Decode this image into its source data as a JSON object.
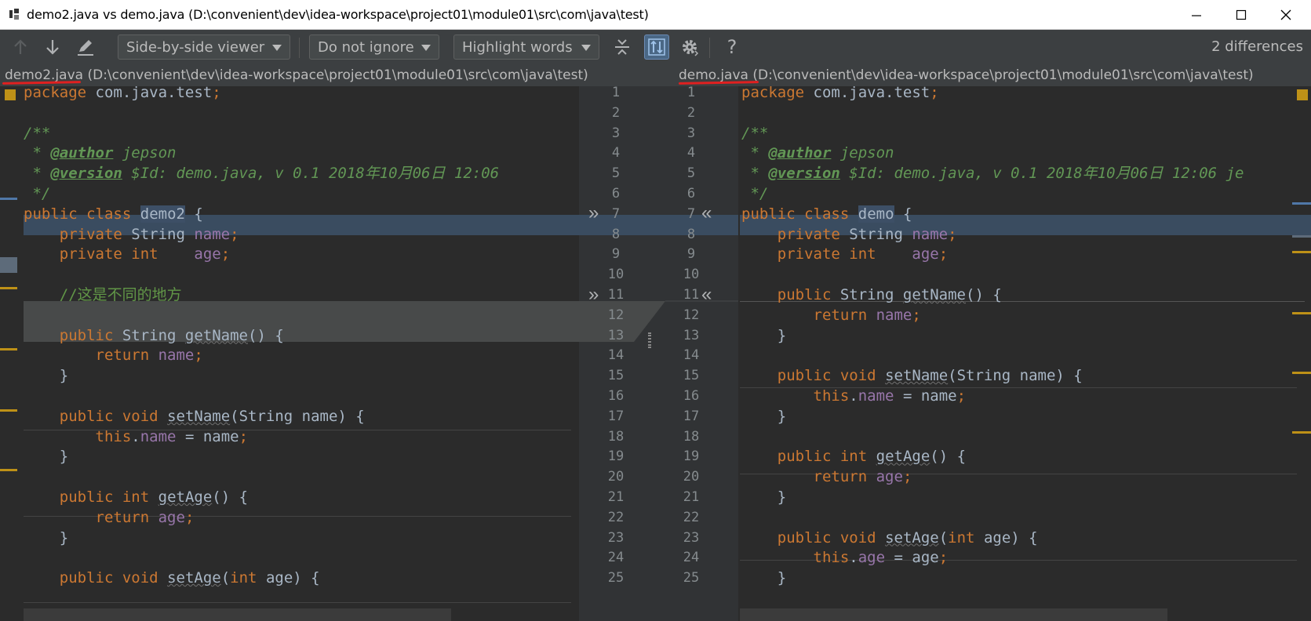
{
  "window": {
    "title": "demo2.java vs demo.java (D:\\convenient\\dev\\idea-workspace\\project01\\module01\\src\\com\\java\\test)"
  },
  "toolbar": {
    "viewer_mode": "Side-by-side viewer",
    "ignore_mode": "Do not ignore",
    "highlight_mode": "Highlight words",
    "differences": "2 differences",
    "help": "?"
  },
  "left_file": {
    "name": "demo2.java",
    "path": " (D:\\convenient\\dev\\idea-workspace\\project01\\module01\\src\\com\\java\\test)"
  },
  "right_file": {
    "name": "demo.java",
    "path": " (D:\\convenient\\dev\\idea-workspace\\project01\\module01\\src\\com\\java\\test)"
  },
  "left_code": [
    "package com.java.test;",
    "",
    "/**",
    " * @author jepson",
    " * @version $Id: demo.java, v 0.1 2018年10月06日 12:06",
    " */",
    "public class demo2 {",
    "    private String name;",
    "    private int    age;",
    "",
    "    //这是不同的地方",
    "",
    "    public String getName() {",
    "        return name;",
    "    }",
    "",
    "    public void setName(String name) {",
    "        this.name = name;",
    "    }",
    "",
    "    public int getAge() {",
    "        return age;",
    "    }",
    "",
    "    public void setAge(int age) {"
  ],
  "right_code": [
    "package com.java.test;",
    "",
    "/**",
    " * @author jepson",
    " * @version $Id: demo.java, v 0.1 2018年10月06日 12:06 je",
    " */",
    "public class demo {",
    "    private String name;",
    "    private int    age;",
    "",
    "    public String getName() {",
    "        return name;",
    "    }",
    "",
    "    public void setName(String name) {",
    "        this.name = name;",
    "    }",
    "",
    "    public int getAge() {",
    "        return age;",
    "    }",
    "",
    "    public void setAge(int age) {",
    "        this.age = age;",
    "    }"
  ],
  "left_line_numbers": [
    "1",
    "2",
    "3",
    "4",
    "5",
    "6",
    "7",
    "8",
    "9",
    "10",
    "11",
    "12",
    "13",
    "14",
    "15",
    "16",
    "17",
    "18",
    "19",
    "20",
    "21",
    "22",
    "23",
    "24",
    "25"
  ],
  "right_line_numbers": [
    "1",
    "2",
    "3",
    "4",
    "5",
    "6",
    "7",
    "8",
    "9",
    "10",
    "11",
    "12",
    "13",
    "14",
    "15",
    "16",
    "17",
    "18",
    "19",
    "20",
    "21",
    "22",
    "23",
    "24",
    "25"
  ],
  "colors": {
    "modified_block": "#3a4c60",
    "deleted_block": "#484a4a",
    "keyword": "#cc7832",
    "comment": "#629755",
    "field": "#9876aa",
    "marker": "#be9117"
  }
}
